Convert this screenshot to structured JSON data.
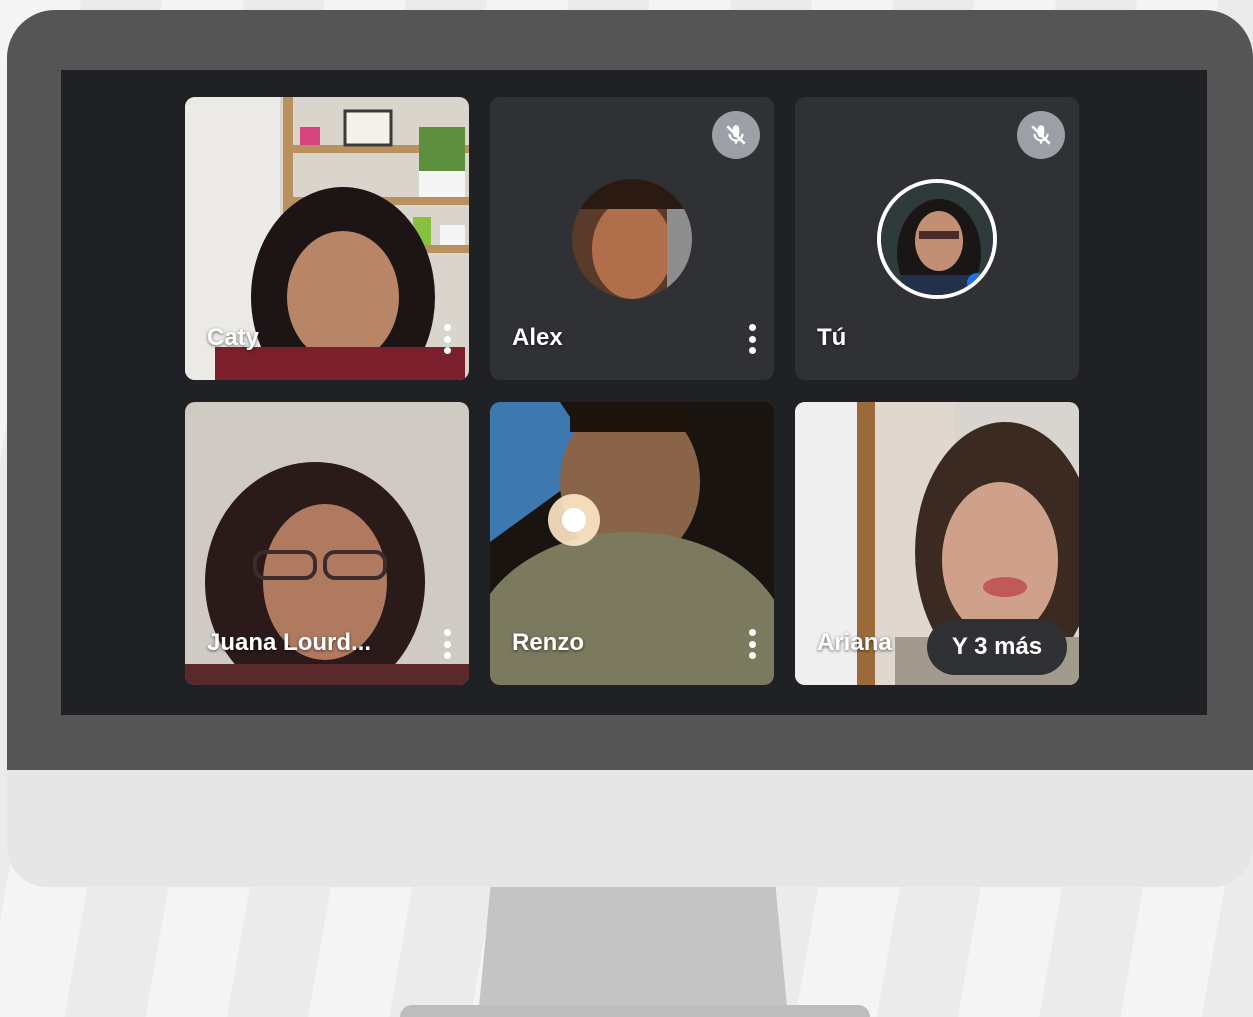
{
  "participants": [
    {
      "name": "Caty",
      "muted": false,
      "has_video": true
    },
    {
      "name": "Alex",
      "muted": true,
      "has_video": false
    },
    {
      "name": "Tú",
      "muted": true,
      "has_video": false
    },
    {
      "name": "Juana Lourd...",
      "muted": false,
      "has_video": true
    },
    {
      "name": "Renzo",
      "muted": false,
      "has_video": true
    },
    {
      "name": "Ariana",
      "muted": false,
      "has_video": true
    }
  ],
  "overflow": {
    "label": "Y 3 más"
  },
  "icons": [
    "mic-off-icon",
    "more-vert-icon"
  ],
  "colors": {
    "screen_bg": "#202124",
    "tile_bg": "#3c4043",
    "bezel": "#555555"
  }
}
